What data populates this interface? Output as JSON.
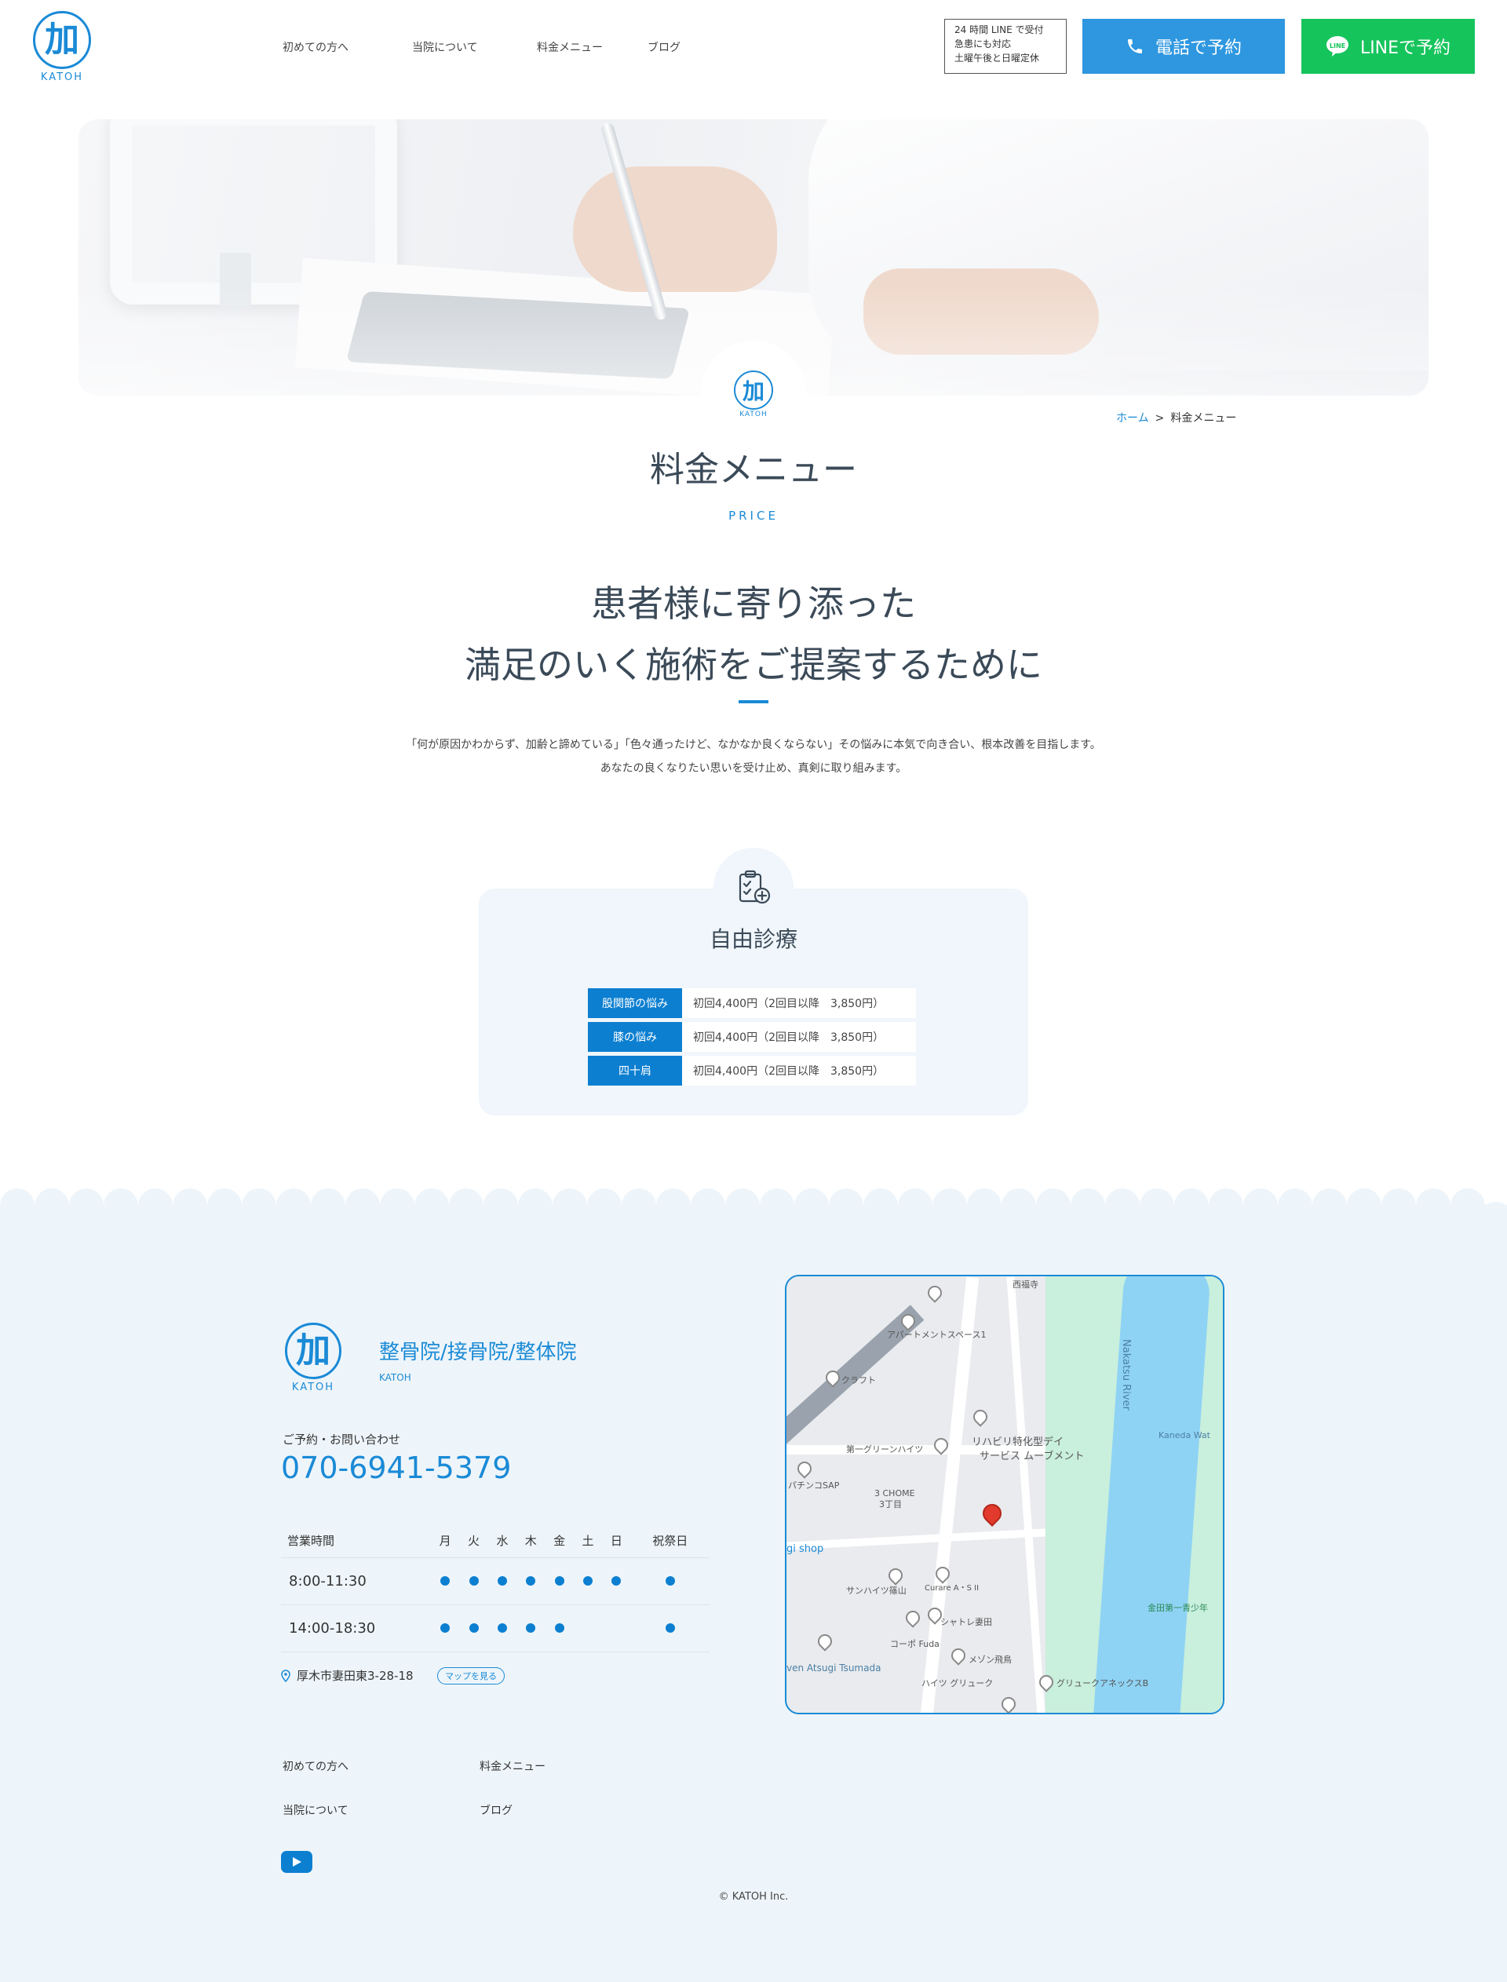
{
  "header": {
    "logo_char": "加",
    "logo_text": "KATOH",
    "nav": [
      "初めての方へ",
      "当院について",
      "料金メニュー",
      "ブログ"
    ],
    "hours_lines": [
      "24 時間 LINE で受付",
      "急患にも対応",
      "土曜午後と日曜定休"
    ],
    "tel_button": "電話で予約",
    "line_button": "LINEで予約"
  },
  "hero": {
    "badge_char": "加",
    "badge_text": "KATOH"
  },
  "breadcrumb": {
    "home": "ホーム",
    "separator": ">",
    "current": "料金メニュー"
  },
  "page": {
    "title": "料金メニュー",
    "subtitle": "PRICE",
    "lead_line1": "患者様に寄り添った",
    "lead_line2": "満足のいく施術をご提案するために",
    "desc_line1": "「何が原因かわからず、加齢と諦めている」「色々通ったけど、なかなか良くならない」その悩みに本気で向き合い、根本改善を目指します。",
    "desc_line2": "あなたの良くなりたい思いを受け止め、真剣に取り組みます。"
  },
  "price_card": {
    "title": "自由診療",
    "rows": [
      {
        "label": "股関節の悩み",
        "value": "初回4,400円（2回目以降　3,850円）"
      },
      {
        "label": "膝の悩み",
        "value": "初回4,400円（2回目以降　3,850円）"
      },
      {
        "label": "四十肩",
        "value": "初回4,400円（2回目以降　3,850円）"
      }
    ]
  },
  "footer": {
    "logo_char": "加",
    "logo_text": "KATOH",
    "title": "整骨院/接骨院/整体院",
    "sub": "KATOH",
    "contact_label": "ご予約・お問い合わせ",
    "tel": "070-6941-5379",
    "hours": {
      "header": [
        "営業時間",
        "月",
        "火",
        "水",
        "木",
        "金",
        "土",
        "日",
        "祝祭日"
      ],
      "rows": [
        {
          "time": "8:00-11:30",
          "open": [
            true,
            true,
            true,
            true,
            true,
            true,
            true,
            true
          ]
        },
        {
          "time": "14:00-18:30",
          "open": [
            true,
            true,
            true,
            true,
            true,
            false,
            false,
            true
          ]
        }
      ]
    },
    "address": "厚木市妻田東3-28-18",
    "map_button": "マップを見る",
    "map_labels": [
      "アパートメントスペース1",
      "クラフト",
      "第一グリーンハイツ",
      "リハビリ特化型デイ",
      "サービス ムーブメント",
      "パチンコSAP",
      "3 CHOME",
      "3丁目",
      "gi shop",
      "サンハイツ篠山",
      "Curare A・S II",
      "シャトレ妻田",
      "コーポ Fuda",
      "メゾン飛鳥",
      "ハイツ グリューク",
      "グリュークアネックスB",
      "Nakatsu River",
      "Kaneda Wat",
      "金田第一青少年",
      "ven Atsugi Tsumada",
      "西福寺"
    ],
    "nav": [
      "初めての方へ",
      "料金メニュー",
      "当院について",
      "ブログ"
    ],
    "copyright": "© KATOH Inc."
  },
  "colors": {
    "brand_blue": "#1a8ad6",
    "line_green": "#16c45c",
    "tel_blue": "#2e97e0",
    "footer_bg": "#eef5fa"
  }
}
